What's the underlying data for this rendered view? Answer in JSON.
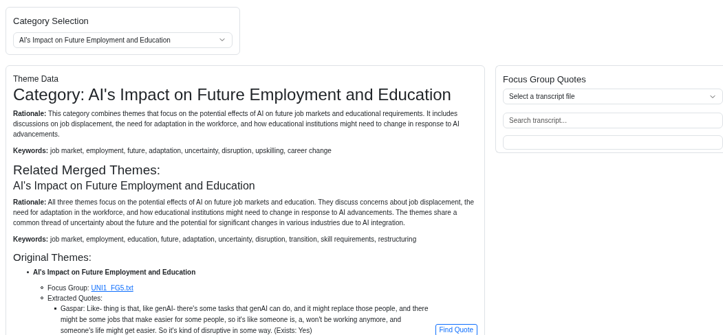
{
  "category_selection": {
    "title": "Category Selection",
    "value": "AI's Impact on Future Employment and Education"
  },
  "theme_data": {
    "label": "Theme Data",
    "heading": "Category: AI's Impact on Future Employment and Education",
    "rationale": "**Rationale:** This category combines themes that focus on the potential effects of AI on future job markets and educational requirements. It includes discussions on job displacement, the need for adaptation in the workforce, and how educational institutions might need to change in response to AI advancements.",
    "keywords": "**Keywords:** job market, employment, future, adaptation, uncertainty, disruption, upskilling, career change",
    "related_heading": "Related Merged Themes:",
    "merged_theme": {
      "title": "AI's Impact on Future Employment and Education",
      "rationale": "**Rationale:** All three themes focus on the potential effects of AI on future job markets and education. They discuss concerns about job displacement, the need for adaptation in the workforce, and how educational institutions might need to change in response to AI advancements. The themes share a common thread of uncertainty about the future and the potential for significant changes in various industries due to AI integration.",
      "keywords": "**Keywords:** job market, employment, education, future, adaptation, uncertainty, disruption, transition, skill requirements, restructuring"
    },
    "original_heading": "Original Themes:",
    "original_themes": [
      {
        "title": "AI's Impact on Future Employment and Education",
        "focus_group_label": "Focus Group:",
        "focus_group_file": "UNI1_FG5.txt",
        "quotes_label": "Extracted Quotes:",
        "quotes": [
          {
            "text": "Gaspar: Like- thing is that, like genAI- there's some tasks that genAI can do, and it might replace those people, and there might be some jobs that make easier for some people, so it's like someone is, a, won't be working anymore, and someone's life might get easier. So it's kind of disruptive in some way. (Exists: Yes)",
            "button": "Find Quote"
          }
        ]
      }
    ]
  },
  "focus_group_quotes": {
    "title": "Focus Group Quotes",
    "transcript_placeholder": "Select a transcript file",
    "search_placeholder": "Search transcript..."
  }
}
